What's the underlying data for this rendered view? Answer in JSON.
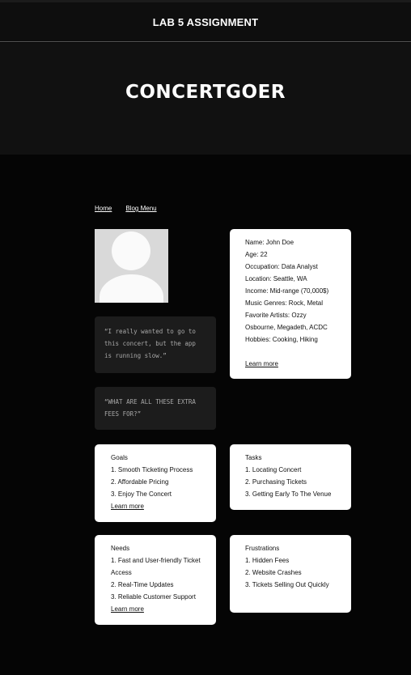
{
  "header": {
    "site_title": "LAB 5 ASSIGNMENT"
  },
  "hero": {
    "title": "CONCERTGOER"
  },
  "nav": {
    "home": "Home",
    "blog_menu": "Blog Menu"
  },
  "quotes": [
    "“I really wanted to go to this concert, but the app is running slow.”",
    "“WHAT ARE ALL THESE EXTRA FEES FOR?”"
  ],
  "profile": {
    "name": "Name: John Doe",
    "age": "Age: 22",
    "occupation": "Occupation: Data Analyst",
    "location": "Location: Seattle, WA",
    "income": "Income: Mid-range (70,000$)",
    "genres": "Music Genres: Rock, Metal",
    "artists": "Favorite Artists: Ozzy Osbourne, Megadeth, ACDC",
    "hobbies": "Hobbies: Cooking, Hiking",
    "learn_more": "Learn more"
  },
  "goals": {
    "title": "Goals",
    "items": [
      "1. Smooth Ticketing Process",
      "2. Affordable Pricing",
      "3. Enjoy The Concert"
    ],
    "learn_more": "Learn more"
  },
  "tasks": {
    "title": "Tasks",
    "items": [
      "1. Locating Concert",
      "2. Purchasing Tickets",
      "3. Getting Early To The Venue"
    ]
  },
  "needs": {
    "title": "Needs",
    "items": [
      "1. Fast and User-friendly Ticket Access",
      "2. Real-Time Updates",
      "3. Reliable Customer Support"
    ],
    "learn_more": "Learn more"
  },
  "frustrations": {
    "title": "Frustrations",
    "items": [
      "1. Hidden Fees",
      "2. Website Crashes",
      "3. Tickets Selling Out Quickly"
    ]
  }
}
